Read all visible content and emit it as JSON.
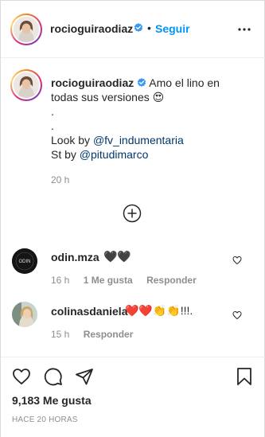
{
  "header": {
    "username": "rocioguiraodiaz",
    "follow_label": "Seguir",
    "separator": "•"
  },
  "caption": {
    "username": "rocioguiraodiaz",
    "text_main": "Amo el lino en todas sus versiones",
    "emoji": "😍",
    "dot_line_1": ".",
    "dot_line_2": ".",
    "look_prefix": "Look by",
    "look_handle": "@fv_indumentaria",
    "st_prefix": "St by",
    "st_handle": "@pitudimarco",
    "time": "20 h"
  },
  "comments": [
    {
      "username": "odin.mza",
      "text": "🖤🖤",
      "time": "16 h",
      "likes": "1 Me gusta",
      "reply": "Responder",
      "avatar_text": "ODIN"
    },
    {
      "username": "colinasdaniela",
      "text": "❤️❤️👏👏!!!.",
      "time": "15 h",
      "reply": "Responder"
    }
  ],
  "actions": {
    "likes_count": "9,183 Me gusta",
    "post_age": "HACE 20 HORAS"
  },
  "icons": {
    "verified": "verified-badge-icon",
    "more": "more-options-icon",
    "load_more": "plus-circle-icon",
    "heart": "heart-icon",
    "comment": "comment-icon",
    "share": "share-icon",
    "save": "bookmark-icon"
  },
  "colors": {
    "link": "#00376b",
    "follow": "#0095f6",
    "verified": "#3897f0",
    "meta": "#8e8e8e",
    "text": "#262626"
  }
}
